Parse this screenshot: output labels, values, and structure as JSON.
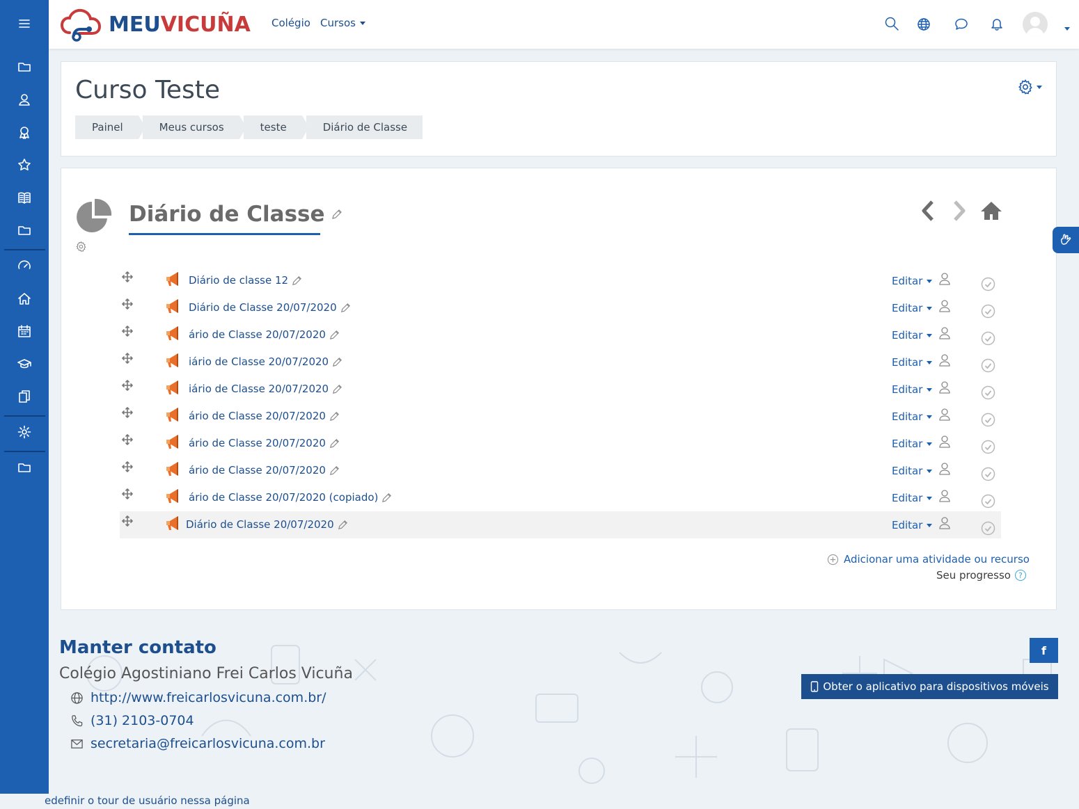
{
  "brand": {
    "part1": "MEU",
    "part2": "VICUÑA"
  },
  "topnav": {
    "college": "Colégio",
    "courses": "Cursos"
  },
  "rail": {
    "items": [
      "menu-icon",
      "folder-icon",
      "users-icon",
      "badge-icon",
      "star-icon",
      "book-icon",
      "folder-icon",
      "dashboard-icon",
      "home-icon",
      "calendar-icon",
      "graduation-cap-icon",
      "copy-icon",
      "gear-icon",
      "folder-icon"
    ]
  },
  "course": {
    "title": "Curso Teste"
  },
  "breadcrumb": [
    "Painel",
    "Meus cursos",
    "teste",
    "Diário de Classe"
  ],
  "section": {
    "title": "Diário de Classe"
  },
  "activities": [
    {
      "name": "Diário de classe 12",
      "edit": "Editar"
    },
    {
      "name": "Diário de Classe 20/07/2020",
      "edit": "Editar"
    },
    {
      "name": "ário de Classe 20/07/2020",
      "edit": "Editar"
    },
    {
      "name": "iário de Classe 20/07/2020",
      "edit": "Editar"
    },
    {
      "name": "iário de Classe 20/07/2020",
      "edit": "Editar"
    },
    {
      "name": "ário de Classe 20/07/2020",
      "edit": "Editar"
    },
    {
      "name": "ário de Classe 20/07/2020",
      "edit": "Editar"
    },
    {
      "name": "ário de Classe 20/07/2020",
      "edit": "Editar"
    },
    {
      "name": "ário de Classe 20/07/2020 (copiado)",
      "edit": "Editar"
    },
    {
      "name": "Diário de Classe 20/07/2020",
      "edit": "Editar"
    }
  ],
  "add_activity": "Adicionar uma atividade ou recurso",
  "progress_label": "Seu progresso",
  "footer": {
    "title": "Manter contato",
    "school": "Colégio Agostiniano Frei Carlos Vicuña",
    "website": "http://www.freicarlosvicuna.com.br/",
    "phone": "(31) 2103-0704",
    "email": "secretaria@freicarlosvicuna.com.br",
    "facebook": "f",
    "app_button": "Obter o aplicativo para dispositivos móveis"
  },
  "tour_reset": "edefinir o tour de usuário nessa página",
  "colors": {
    "primary": "#1d5fb0",
    "brand_red": "#c93b3b",
    "brand_blue": "#1d4f8f",
    "activity_orange": "#e8702a"
  }
}
